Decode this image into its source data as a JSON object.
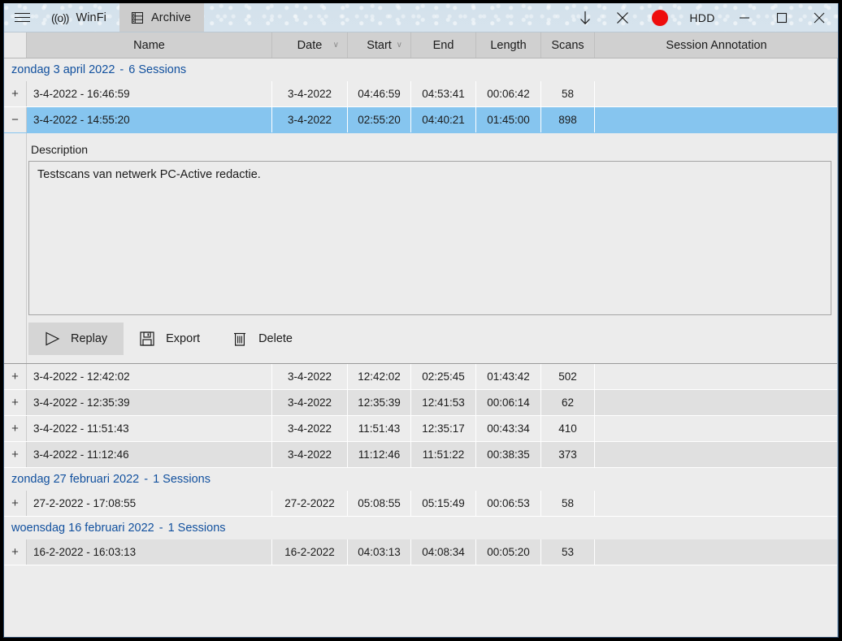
{
  "titlebar": {
    "menu_icon": "hamburger-icon",
    "tabs": [
      {
        "label": "WinFi",
        "icon": "wifi-icon",
        "active": false
      },
      {
        "label": "Archive",
        "icon": "archive-icon",
        "active": true
      }
    ],
    "actions": [
      {
        "name": "download-button",
        "glyph": "↓"
      },
      {
        "name": "close-session-button",
        "glyph": "✕"
      },
      {
        "name": "record-button",
        "glyph": "record-dot"
      },
      {
        "name": "hdd-button",
        "glyph": "HDD"
      }
    ],
    "hdd_label": "HDD",
    "window_controls": {
      "minimize": "─",
      "maximize": "□",
      "close": "✕"
    }
  },
  "grid": {
    "columns": [
      {
        "key": "expander",
        "label": ""
      },
      {
        "key": "name",
        "label": "Name"
      },
      {
        "key": "date",
        "label": "Date",
        "sortable": true,
        "caret": "∨"
      },
      {
        "key": "start",
        "label": "Start",
        "sortable": true,
        "caret": "∨"
      },
      {
        "key": "end",
        "label": "End"
      },
      {
        "key": "length",
        "label": "Length"
      },
      {
        "key": "scans",
        "label": "Scans"
      },
      {
        "key": "annotation",
        "label": "Session Annotation"
      }
    ],
    "groups": [
      {
        "header": "zondag 3 april 2022",
        "separator": "-",
        "count_label": "6 Sessions",
        "rows": [
          {
            "expander": "+",
            "name": "3-4-2022  -  16:46:59",
            "date": "3-4-2022",
            "start": "04:46:59",
            "end": "04:53:41",
            "length": "00:06:42",
            "scans": "58",
            "annotation": "",
            "selected": false,
            "expanded": false
          },
          {
            "expander": "−",
            "name": "3-4-2022  -  14:55:20",
            "date": "3-4-2022",
            "start": "02:55:20",
            "end": "04:40:21",
            "length": "01:45:00",
            "scans": "898",
            "annotation": "",
            "selected": true,
            "expanded": true
          },
          {
            "expander": "+",
            "name": "3-4-2022  -  12:42:02",
            "date": "3-4-2022",
            "start": "12:42:02",
            "end": "02:25:45",
            "length": "01:43:42",
            "scans": "502",
            "annotation": "",
            "selected": false,
            "expanded": false
          },
          {
            "expander": "+",
            "name": "3-4-2022  -  12:35:39",
            "date": "3-4-2022",
            "start": "12:35:39",
            "end": "12:41:53",
            "length": "00:06:14",
            "scans": "62",
            "annotation": "",
            "selected": false,
            "expanded": false
          },
          {
            "expander": "+",
            "name": "3-4-2022  -  11:51:43",
            "date": "3-4-2022",
            "start": "11:51:43",
            "end": "12:35:17",
            "length": "00:43:34",
            "scans": "410",
            "annotation": "",
            "selected": false,
            "expanded": false
          },
          {
            "expander": "+",
            "name": "3-4-2022  -  11:12:46",
            "date": "3-4-2022",
            "start": "11:12:46",
            "end": "11:51:22",
            "length": "00:38:35",
            "scans": "373",
            "annotation": "",
            "selected": false,
            "expanded": false
          }
        ]
      },
      {
        "header": "zondag 27 februari 2022",
        "separator": "-",
        "count_label": "1 Sessions",
        "rows": [
          {
            "expander": "+",
            "name": "27-2-2022  -  17:08:55",
            "date": "27-2-2022",
            "start": "05:08:55",
            "end": "05:15:49",
            "length": "00:06:53",
            "scans": "58",
            "annotation": "",
            "selected": false,
            "expanded": false
          }
        ]
      },
      {
        "header": "woensdag 16 februari 2022",
        "separator": "-",
        "count_label": "1 Sessions",
        "rows": [
          {
            "expander": "+",
            "name": "16-2-2022  -  16:03:13",
            "date": "16-2-2022",
            "start": "04:03:13",
            "end": "04:08:34",
            "length": "00:05:20",
            "scans": "53",
            "annotation": "",
            "selected": false,
            "expanded": false
          }
        ]
      }
    ]
  },
  "detail": {
    "description_label": "Description",
    "description_text": "Testscans van netwerk PC-Active redactie.",
    "buttons": [
      {
        "name": "replay-button",
        "label": "Replay",
        "icon": "play-icon",
        "hover": true
      },
      {
        "name": "export-button",
        "label": "Export",
        "icon": "save-icon",
        "hover": false
      },
      {
        "name": "delete-button",
        "label": "Delete",
        "icon": "trash-icon",
        "hover": false
      }
    ]
  },
  "colors": {
    "selection": "#86c5ef",
    "group_header_text": "#11509e",
    "record_red": "#ee0c0c",
    "titlebar": "#d6e3ed",
    "tab_active": "#cccccc",
    "grid_header": "#d0d0d0",
    "row": "#ececec",
    "row_alt": "#e0e0e0"
  }
}
